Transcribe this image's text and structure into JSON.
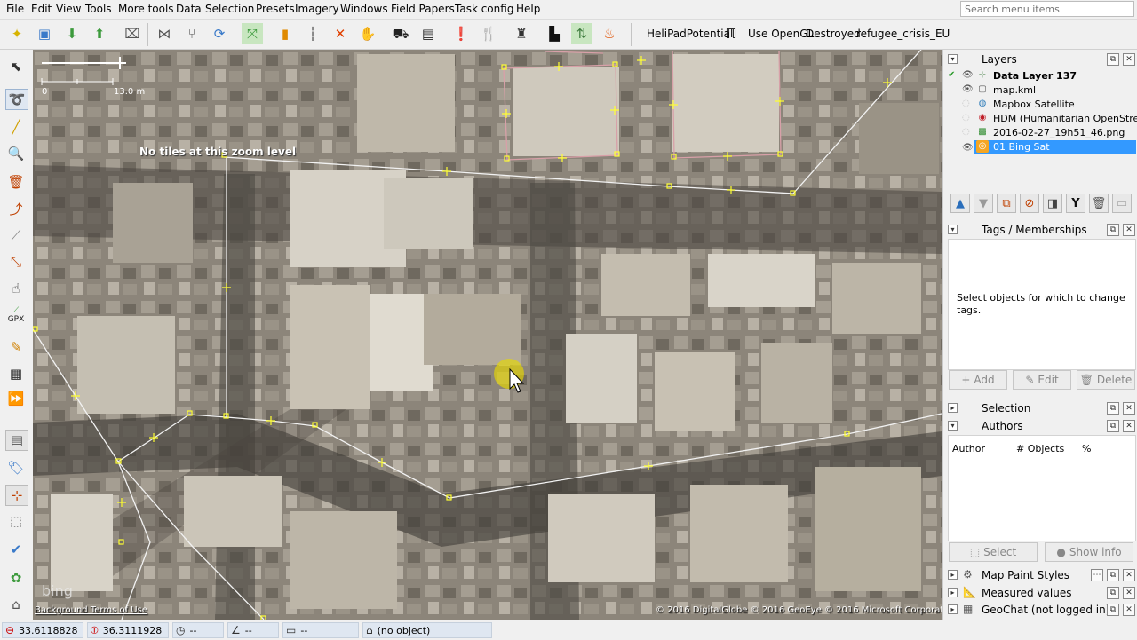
{
  "menu": {
    "items": [
      "File",
      "Edit",
      "View",
      "Tools",
      "More tools",
      "Data",
      "Selection",
      "Presets",
      "Imagery",
      "Windows",
      "Field Papers",
      "Task config",
      "Help"
    ],
    "search_placeholder": "Search menu items"
  },
  "toolbar": {
    "heli_label": "HeliPadPotential",
    "opengl_label": "Use OpenGL",
    "destroyed_label": "Destroyed",
    "refugee_label": "refugee_crisis_EU"
  },
  "map": {
    "no_tiles": "No tiles at this zoom level",
    "scale_start": "0",
    "scale_end": "13.0 m",
    "bing_logo": "bing",
    "bg_terms": "Background Terms of Use",
    "copyright": "© 2016 DigitalGlobe © 2016 GeoEye © 2016 Microsoft Corporation"
  },
  "status": {
    "lat": "33.6118828",
    "lon": "36.3111928",
    "heading": "--",
    "angle": "--",
    "distance": "--",
    "selection": "(no object)"
  },
  "layers_panel": {
    "title": "Layers",
    "layers": [
      {
        "name": "Data Layer 137",
        "icon": "data-layer-icon",
        "bold": true,
        "visible": true,
        "active": true,
        "selected": false
      },
      {
        "name": "map.kml",
        "icon": "kml-icon",
        "bold": false,
        "visible": true,
        "active": false,
        "selected": false
      },
      {
        "name": "Mapbox Satellite",
        "icon": "imagery-icon",
        "bold": false,
        "visible": false,
        "active": false,
        "selected": false
      },
      {
        "name": "HDM (Humanitarian OpenStre...",
        "icon": "hdm-icon",
        "bold": false,
        "visible": false,
        "active": false,
        "selected": false
      },
      {
        "name": "2016-02-27_19h51_46.png",
        "icon": "image-icon",
        "bold": false,
        "visible": false,
        "active": false,
        "selected": false
      },
      {
        "name": "01 Bing Sat",
        "icon": "bing-icon",
        "bold": false,
        "visible": true,
        "active": false,
        "selected": true
      }
    ]
  },
  "tags_panel": {
    "title": "Tags / Memberships",
    "empty_text": "Select objects for which to change tags.",
    "add_label": "Add",
    "edit_label": "Edit",
    "delete_label": "Delete"
  },
  "selection_panel": {
    "title": "Selection"
  },
  "authors_panel": {
    "title": "Authors",
    "col_author": "Author",
    "col_objects": "# Objects",
    "col_percent": "%",
    "select_label": "Select",
    "show_info_label": "Show info"
  },
  "bottom_panels": {
    "map_paint": "Map Paint Styles",
    "measured": "Measured values",
    "geochat": "GeoChat (not logged in)"
  },
  "colors": {
    "selection_blue": "#3399ff",
    "way_color": "#f2f2f2",
    "node_color": "#ffff00"
  }
}
